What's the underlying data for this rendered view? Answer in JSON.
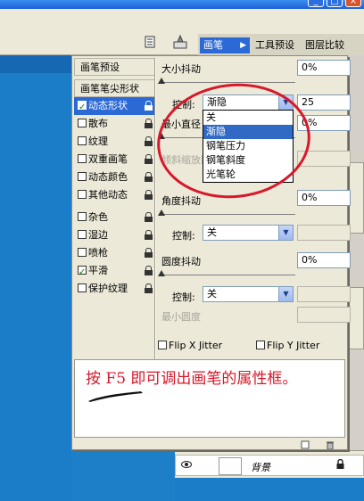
{
  "window": {
    "min": "_",
    "max": "□",
    "close": "×"
  },
  "palette_well": {
    "tabs": [
      {
        "label": "画笔",
        "arrow": "▶"
      },
      {
        "label": "工具预设"
      },
      {
        "label": "图层比较"
      }
    ]
  },
  "brushes": {
    "presets_header": "画笔预设",
    "tip_shape_header": "画笔笔尖形状",
    "options": [
      {
        "label": "动态形状",
        "checked": true,
        "selected": true
      },
      {
        "label": "散布",
        "checked": false
      },
      {
        "label": "纹理",
        "checked": false
      },
      {
        "label": "双重画笔",
        "checked": false
      },
      {
        "label": "动态颜色",
        "checked": false
      },
      {
        "label": "其他动态",
        "checked": false
      },
      {
        "label": "杂色",
        "checked": false
      },
      {
        "label": "湿边",
        "checked": false
      },
      {
        "label": "喷枪",
        "checked": false
      },
      {
        "label": "平滑",
        "checked": true
      },
      {
        "label": "保护纹理",
        "checked": false
      }
    ],
    "size_jitter": {
      "label": "大小抖动",
      "value": "0%"
    },
    "size_control": {
      "label": "控制:",
      "value": "渐隐",
      "steps": "25"
    },
    "min_diameter": {
      "label": "最小直径",
      "value": "0%"
    },
    "tilt_scale": {
      "label": "倾斜缩放比例"
    },
    "control_options": [
      "关",
      "渐隐",
      "钢笔压力",
      "钢笔斜度",
      "光笔轮"
    ],
    "selected_option": "渐隐",
    "angle_jitter": {
      "label": "角度抖动",
      "value": "0%"
    },
    "angle_control": {
      "label": "控制:",
      "value": "关"
    },
    "roundness_jitter": {
      "label": "圆度抖动",
      "value": "0%"
    },
    "roundness_control": {
      "label": "控制:",
      "value": "关"
    },
    "min_roundness": {
      "label": "最小圆度"
    },
    "flip_x": "Flip X Jitter",
    "flip_y": "Flip Y Jitter",
    "preview_note": "按 F5 即可调出画笔的属性框。"
  },
  "layers": {
    "layer_name": "背景"
  },
  "colors": {
    "accent": "#2b6ad6",
    "annotation": "#d8182a",
    "panel": "#ece9d8",
    "desktop": "#1e7fc9"
  },
  "icons": {
    "doc": "📄",
    "brush_tool": "🖌",
    "eye": "👁",
    "lock": "🔒"
  }
}
